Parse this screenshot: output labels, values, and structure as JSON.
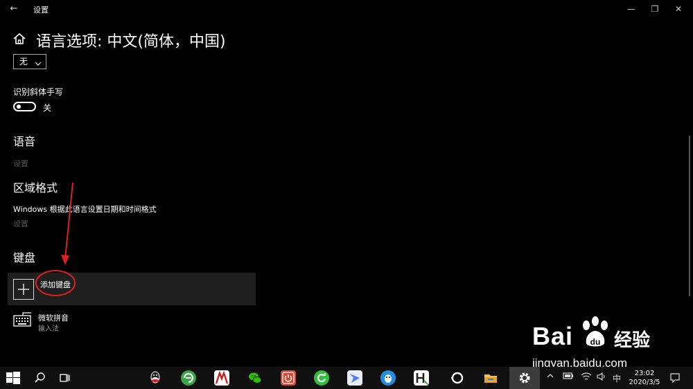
{
  "window": {
    "title": "设置",
    "back_icon": "back-arrow-icon",
    "minimize_glyph": "—",
    "restore_glyph": "❐",
    "close_glyph": "✕"
  },
  "header": {
    "home_icon": "home-icon",
    "title": "语言选项: 中文(简体，中国)"
  },
  "dropdown": {
    "value": "无"
  },
  "handwriting": {
    "label": "识别斜体手写",
    "toggle_state": "关",
    "on": false
  },
  "sections": {
    "speech": {
      "heading": "语音",
      "link": "设置"
    },
    "region": {
      "heading": "区域格式",
      "description": "Windows 根据此语言设置日期和时间格式",
      "link": "设置"
    },
    "keyboard": {
      "heading": "键盘",
      "add_label": "添加键盘",
      "items": [
        {
          "name": "微软拼音",
          "subtitle": "输入法",
          "icon": "keyboard-icon"
        }
      ]
    }
  },
  "watermark": {
    "brand": "Bai",
    "brand_suffix": "经验",
    "url": "jingyan.baidu.com"
  },
  "taskbar": {
    "apps": [
      "qq-icon",
      "browser-icon",
      "red-app-icon",
      "wechat-icon",
      "power-app-icon",
      "refresh-app-icon",
      "feishu-icon",
      "penguin-app-icon",
      "hbuilder-icon",
      "circle-app-icon",
      "file-explorer-icon",
      "settings-icon"
    ],
    "ime": "中",
    "time": "23:02",
    "date": "2020/3/5"
  },
  "colors": {
    "background": "#000000",
    "row_highlight": "#1f1f1f",
    "muted_link": "#555555",
    "annotation_red": "#e02020"
  }
}
